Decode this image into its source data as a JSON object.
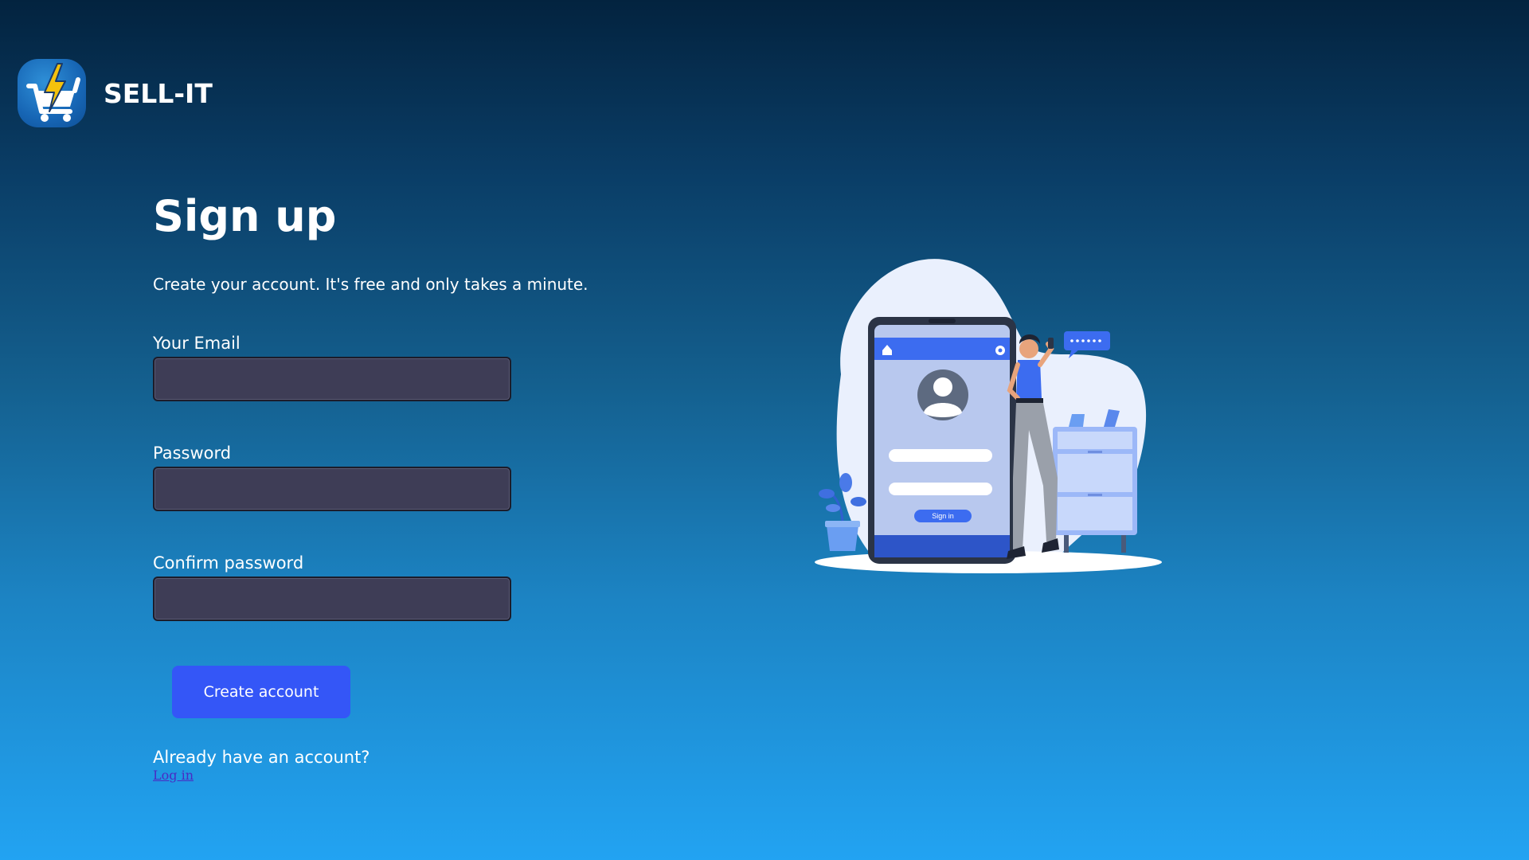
{
  "brand": {
    "name": "SELL-IT",
    "logo_icon": "shopping-cart-lightning-icon"
  },
  "signup": {
    "title": "Sign up",
    "subtitle": "Create your account. It's free and only takes a minute.",
    "email_label": "Your Email",
    "email_value": "",
    "password_label": "Password",
    "password_value": "",
    "confirm_label": "Confirm password",
    "confirm_value": "",
    "submit_label": "Create account",
    "already_text": "Already have an account?",
    "login_link": "Log in"
  },
  "illustration": {
    "icon": "mobile-login-illustration",
    "signin_button": "Sign in"
  },
  "colors": {
    "accent": "#3456f7",
    "input_bg": "#3e3d56",
    "link": "#4a2ac4"
  }
}
